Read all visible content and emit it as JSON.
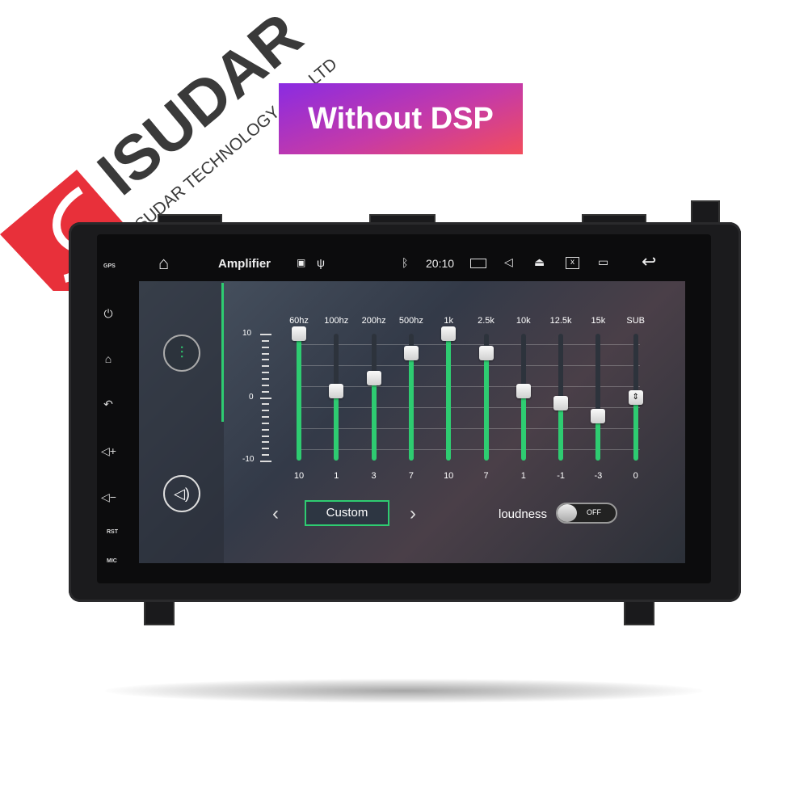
{
  "brand": {
    "logo_text": "ISUDAR",
    "logo_subtext": "ISUDAR TECHNOLOGY CO., LTD",
    "logo_color": "#e8303a"
  },
  "banner": {
    "text": "Without DSP"
  },
  "device": {
    "hw_labels": {
      "gps": "GPS",
      "rst": "RST",
      "mic": "MIC"
    },
    "hw_buttons": [
      "power-icon",
      "home-icon",
      "back-icon",
      "volume-up-icon",
      "volume-down-icon"
    ]
  },
  "status_bar": {
    "title": "Amplifier",
    "time": "20:10",
    "icons": [
      "home-icon",
      "image-icon",
      "usb-icon",
      "bluetooth-icon",
      "camera-icon",
      "volume-icon",
      "eject-icon",
      "screen-off-icon",
      "recent-apps-icon",
      "back-icon"
    ]
  },
  "sidebar": {
    "items": [
      {
        "icon": "equalizer-icon",
        "active": true
      },
      {
        "icon": "speaker-icon",
        "active": false
      }
    ]
  },
  "equalizer": {
    "scale": {
      "max": "10",
      "mid": "0",
      "min": "-10"
    },
    "range": [
      -10,
      10
    ],
    "bands": [
      {
        "label": "60hz",
        "value": 10
      },
      {
        "label": "100hz",
        "value": 1
      },
      {
        "label": "200hz",
        "value": 3
      },
      {
        "label": "500hz",
        "value": 7
      },
      {
        "label": "1k",
        "value": 10
      },
      {
        "label": "2.5k",
        "value": 7
      },
      {
        "label": "10k",
        "value": 1
      },
      {
        "label": "12.5k",
        "value": -1
      },
      {
        "label": "15k",
        "value": -3
      },
      {
        "label": "SUB",
        "value": 0
      }
    ],
    "accent": "#2ecc71"
  },
  "preset": {
    "label": "Custom"
  },
  "loudness": {
    "label": "loudness",
    "state": "OFF"
  }
}
